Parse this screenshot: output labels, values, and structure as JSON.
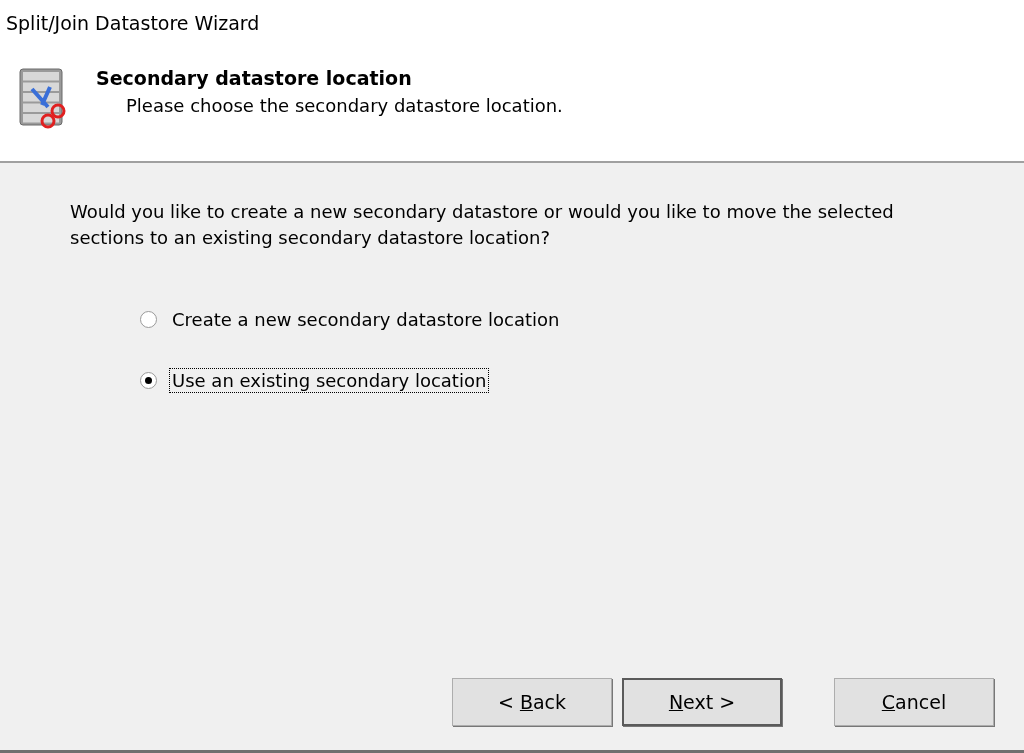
{
  "window": {
    "title": "Split/Join Datastore Wizard"
  },
  "header": {
    "title": "Secondary datastore location",
    "subtitle": "Please choose the secondary datastore location."
  },
  "question": "Would you like to create a new secondary datastore or would you like to move the selected sections to an existing secondary datastore location?",
  "options": [
    {
      "label": "Create a new secondary datastore location",
      "selected": false,
      "focused": false
    },
    {
      "label": "Use an existing secondary location",
      "selected": true,
      "focused": true
    }
  ],
  "buttons": [
    {
      "before": "< ",
      "mnemonic": "B",
      "after": "ack",
      "default": false
    },
    {
      "mnemonic": "N",
      "after": "ext >",
      "default": true
    },
    {
      "mnemonic": "C",
      "after": "ancel",
      "default": false
    }
  ]
}
